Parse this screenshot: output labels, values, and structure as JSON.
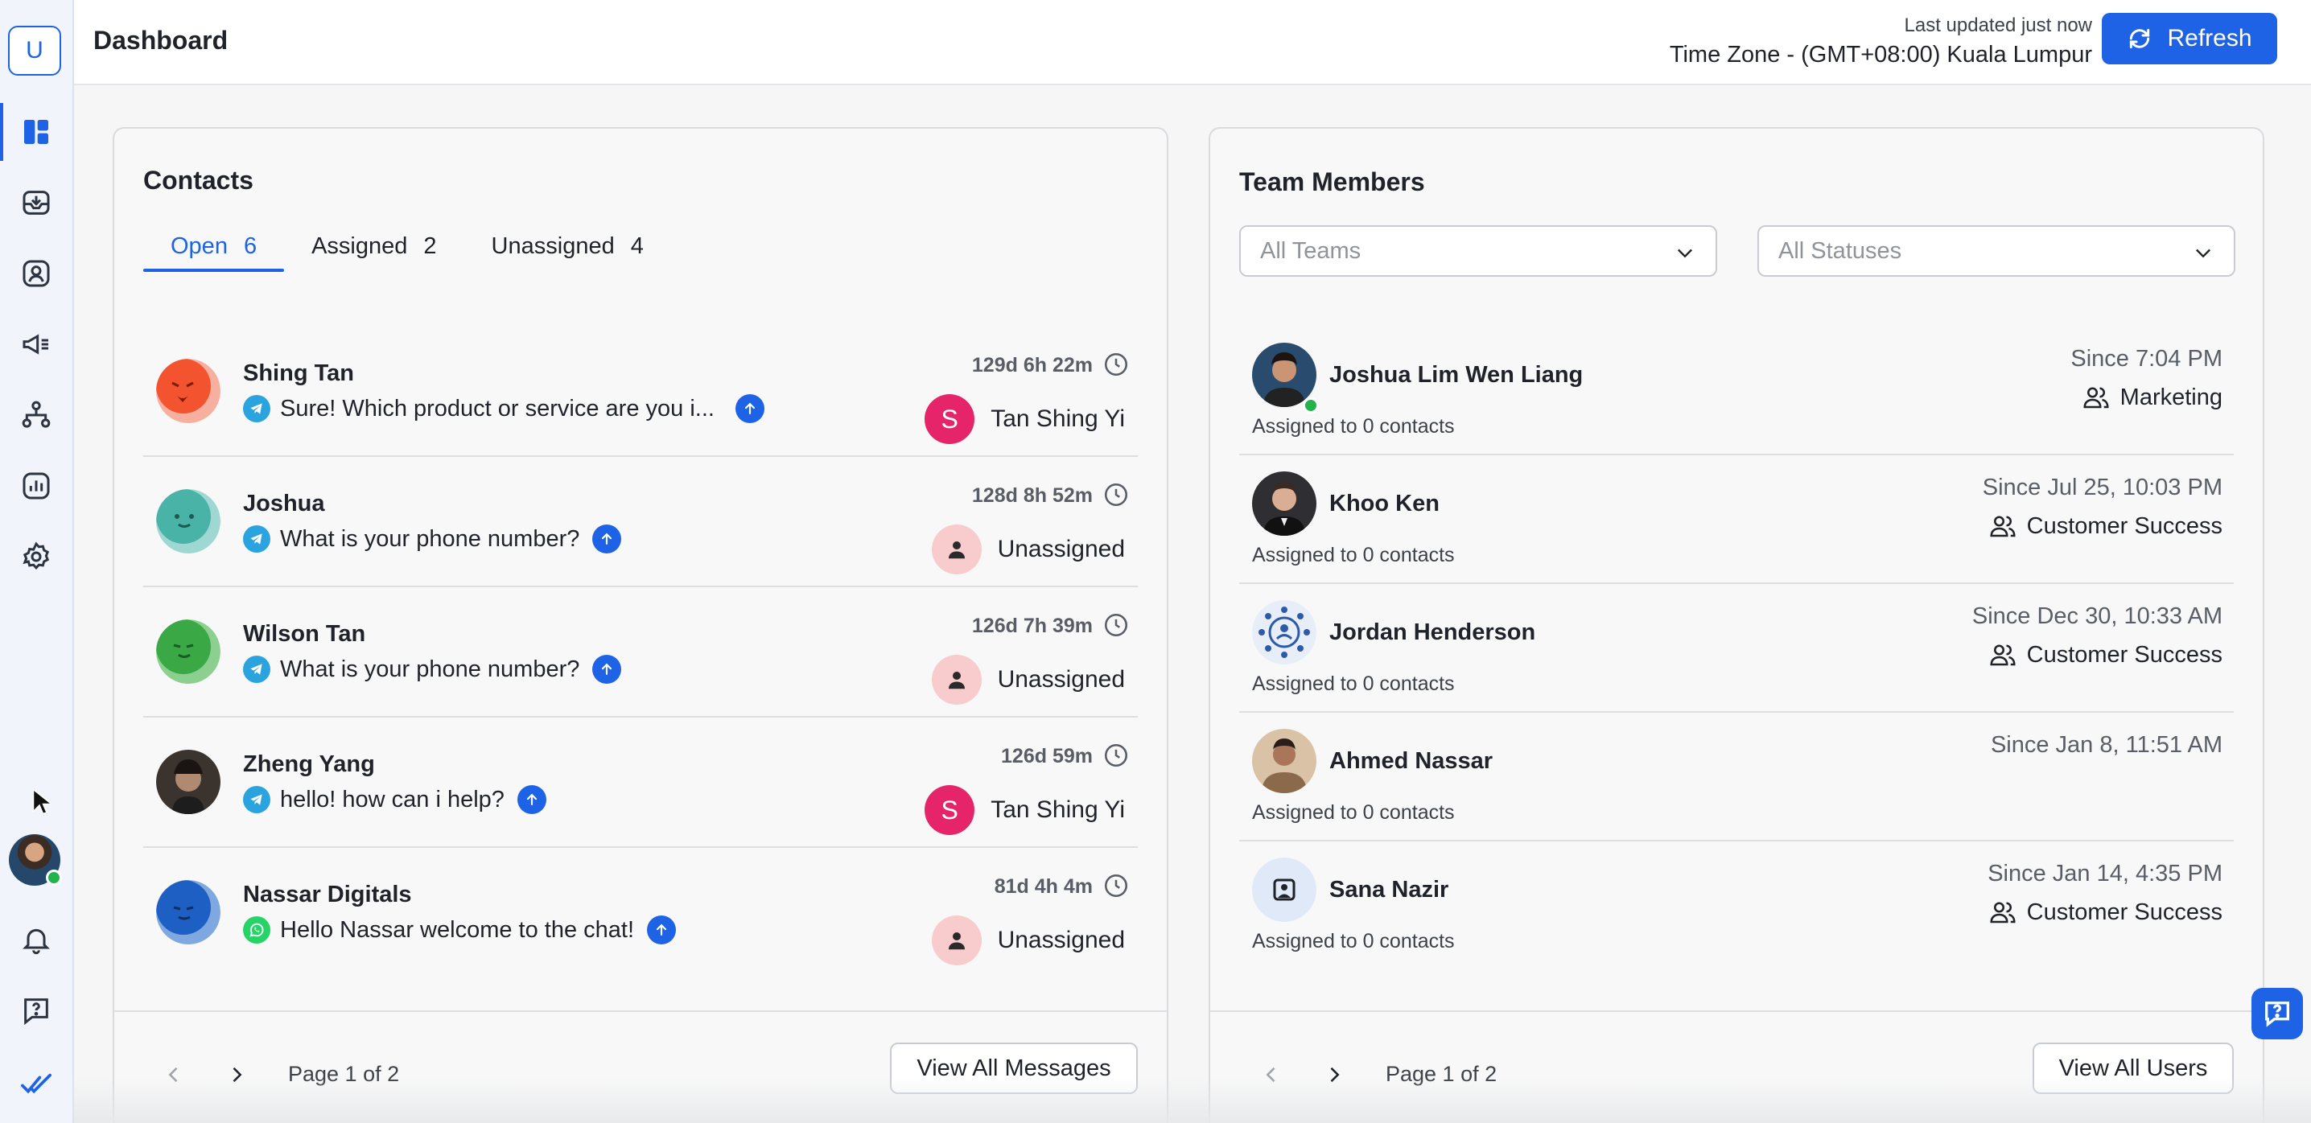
{
  "app": {
    "logo_letter": "U"
  },
  "header": {
    "title": "Dashboard",
    "last_updated": "Last updated just now",
    "timezone": "Time Zone - (GMT+08:00) Kuala Lumpur",
    "refresh_label": "Refresh"
  },
  "sidebar": {
    "items": [
      {
        "icon": "dashboard-icon",
        "active": true
      },
      {
        "icon": "inbox-icon"
      },
      {
        "icon": "contacts-icon"
      },
      {
        "icon": "megaphone-icon"
      },
      {
        "icon": "workflow-icon"
      },
      {
        "icon": "reports-icon"
      },
      {
        "icon": "settings-icon"
      }
    ],
    "bottom": [
      "notification-icon",
      "help-icon",
      "brand-icon"
    ]
  },
  "contacts": {
    "title": "Contacts",
    "tabs": [
      {
        "label": "Open",
        "count": "6"
      },
      {
        "label": "Assigned",
        "count": "2"
      },
      {
        "label": "Unassigned",
        "count": "4"
      }
    ],
    "rows": [
      {
        "name": "Shing Tan",
        "channel": "telegram",
        "message": "Sure! Which product or service are you i...",
        "time": "129d 6h 22m",
        "assignee": "Tan Shing Yi",
        "assignee_initial": "S"
      },
      {
        "name": "Joshua",
        "channel": "telegram",
        "message": "What is your phone number?",
        "time": "128d 8h 52m",
        "assignee": "Unassigned"
      },
      {
        "name": "Wilson Tan",
        "channel": "telegram",
        "message": "What is your phone number?",
        "time": "126d 7h 39m",
        "assignee": "Unassigned"
      },
      {
        "name": "Zheng Yang",
        "channel": "telegram",
        "message": "hello! how can i help?",
        "time": "126d 59m",
        "assignee": "Tan Shing Yi",
        "assignee_initial": "S"
      },
      {
        "name": "Nassar Digitals",
        "channel": "whatsapp",
        "message": "Hello Nassar welcome to the chat!",
        "time": "81d 4h 4m",
        "assignee": "Unassigned"
      }
    ],
    "pagination": "Page 1 of 2",
    "view_all": "View All Messages"
  },
  "team": {
    "title": "Team Members",
    "team_filter_placeholder": "All Teams",
    "status_filter_placeholder": "All Statuses",
    "members": [
      {
        "name": "Joshua Lim Wen Liang",
        "assigned": "Assigned to 0 contacts",
        "since": "Since 7:04 PM",
        "team": "Marketing",
        "online": true
      },
      {
        "name": "Khoo Ken",
        "assigned": "Assigned to 0 contacts",
        "since": "Since Jul 25, 10:03 PM",
        "team": "Customer Success"
      },
      {
        "name": "Jordan Henderson",
        "assigned": "Assigned to 0 contacts",
        "since": "Since Dec 30, 10:33 AM",
        "team": "Customer Success"
      },
      {
        "name": "Ahmed Nassar",
        "assigned": "Assigned to 0 contacts",
        "since": "Since Jan 8, 11:51 AM",
        "team": ""
      },
      {
        "name": "Sana Nazir",
        "assigned": "Assigned to 0 contacts",
        "since": "Since Jan 14, 4:35 PM",
        "team": "Customer Success"
      }
    ],
    "pagination": "Page 1 of 2",
    "view_all": "View All Users"
  },
  "colors": {
    "accent": "#1e63e6",
    "online": "#22b34c",
    "assignee_badge": "#e5246a",
    "unassigned_badge": "#f8cccc"
  }
}
